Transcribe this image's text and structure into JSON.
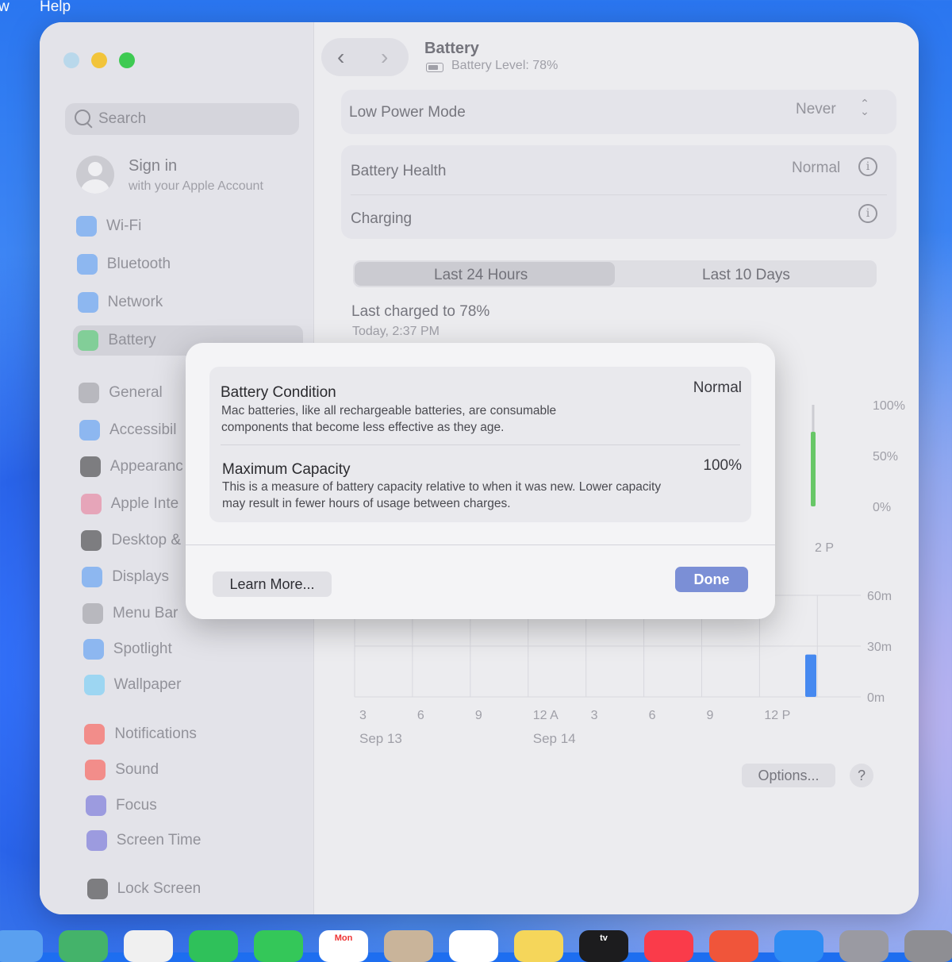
{
  "menubar": {
    "item_partial": "w",
    "help": "Help"
  },
  "window": {
    "sidebar": {
      "search_placeholder": "Search",
      "account": {
        "name": "Sign in",
        "subtitle": "with your Apple Account"
      },
      "items": [
        {
          "label": "Wi-Fi",
          "icon": "wifi-icon",
          "color": "#3b8cf5"
        },
        {
          "label": "Bluetooth",
          "icon": "bluetooth-icon",
          "color": "#3b8cf5"
        },
        {
          "label": "Network",
          "icon": "globe-icon",
          "color": "#3b8cf5"
        },
        {
          "label": "Battery",
          "icon": "battery-icon",
          "color": "#34c759"
        },
        {
          "label": "General",
          "icon": "gear-icon",
          "color": "#8e8e93"
        },
        {
          "label": "Accessibil",
          "icon": "accessibility-icon",
          "color": "#3b8cf5"
        },
        {
          "label": "Appearanc",
          "icon": "appearance-icon",
          "color": "#1c1c1e"
        },
        {
          "label": "Apple Inte",
          "icon": "apple-intelligence-icon",
          "color": "#e86a8a"
        },
        {
          "label": "Desktop &",
          "icon": "desktop-dock-icon",
          "color": "#1c1c1e"
        },
        {
          "label": "Displays",
          "icon": "displays-icon",
          "color": "#3b8cf5"
        },
        {
          "label": "Menu Bar",
          "icon": "menu-bar-icon",
          "color": "#8e8e93"
        },
        {
          "label": "Spotlight",
          "icon": "spotlight-icon",
          "color": "#3b8cf5"
        },
        {
          "label": "Wallpaper",
          "icon": "wallpaper-icon",
          "color": "#5ac8fa"
        },
        {
          "label": "Notifications",
          "icon": "notifications-icon",
          "color": "#ff3b30"
        },
        {
          "label": "Sound",
          "icon": "sound-icon",
          "color": "#ff3b30"
        },
        {
          "label": "Focus",
          "icon": "focus-icon",
          "color": "#5856d6"
        },
        {
          "label": "Screen Time",
          "icon": "screen-time-icon",
          "color": "#5856d6"
        },
        {
          "label": "Lock Screen",
          "icon": "lock-icon",
          "color": "#1c1c1e"
        }
      ]
    },
    "header": {
      "title": "Battery",
      "subtitle": "Battery Level: 78%",
      "back": "‹",
      "forward": "›"
    },
    "low_power": {
      "label": "Low Power Mode",
      "value": "Never",
      "stepper": "⌃⌄"
    },
    "health": {
      "label": "Battery Health",
      "value": "Normal",
      "info": "i"
    },
    "charging": {
      "label": "Charging",
      "info": "i"
    },
    "tabs": [
      {
        "label": "Last 24 Hours"
      },
      {
        "label": "Last 10 Days"
      }
    ],
    "last_charged": {
      "title": "Last charged to 78%",
      "time": "Today, 2:37 PM"
    },
    "chart_data": [
      {
        "type": "bar",
        "title": "",
        "ylabels": [
          "100%",
          "50%",
          "0%"
        ],
        "xlabel_visible": "2 P",
        "series": [
          {
            "values": [
              100
            ]
          }
        ],
        "ylim": [
          0,
          100
        ]
      },
      {
        "type": "bar",
        "title": "",
        "ylabels": [
          "60m",
          "30m",
          "0m"
        ],
        "xticks": [
          "3",
          "6",
          "9",
          "12 A",
          "3",
          "6",
          "9",
          "12 P"
        ],
        "dates": [
          "Sep 13",
          "Sep 14"
        ],
        "series": [
          {
            "values": [
              0,
              0,
              0,
              0,
              0,
              0,
              0,
              25
            ]
          }
        ],
        "ylim": [
          0,
          60
        ]
      }
    ],
    "footer": {
      "options": "Options...",
      "help": "?"
    }
  },
  "dialog": {
    "condition": {
      "title": "Battery Condition",
      "value": "Normal",
      "text": "Mac batteries, like all rechargeable batteries, are consumable components that become less effective as they age."
    },
    "capacity": {
      "title": "Maximum Capacity",
      "value": "100%",
      "text": "This is a measure of battery capacity relative to when it was new. Lower capacity may result in fewer hours of usage between charges."
    },
    "learn_more": "Learn More...",
    "done": "Done",
    "accent": "#7b8fd6"
  },
  "dock": {
    "items": [
      {
        "icon": "finder-icon"
      },
      {
        "icon": "maps-icon"
      },
      {
        "icon": "photos-icon"
      },
      {
        "icon": "facetime-icon"
      },
      {
        "icon": "messages-icon"
      },
      {
        "icon": "calendar-icon",
        "label": "Mon"
      },
      {
        "icon": "contacts-icon"
      },
      {
        "icon": "reminders-icon"
      },
      {
        "icon": "notes-icon"
      },
      {
        "icon": "apple-tv-icon",
        "label": "tv"
      },
      {
        "icon": "music-icon"
      },
      {
        "icon": "launchpad-icon"
      },
      {
        "icon": "app-store-icon"
      },
      {
        "icon": "calculator-icon"
      },
      {
        "icon": "system-settings-icon"
      }
    ]
  }
}
